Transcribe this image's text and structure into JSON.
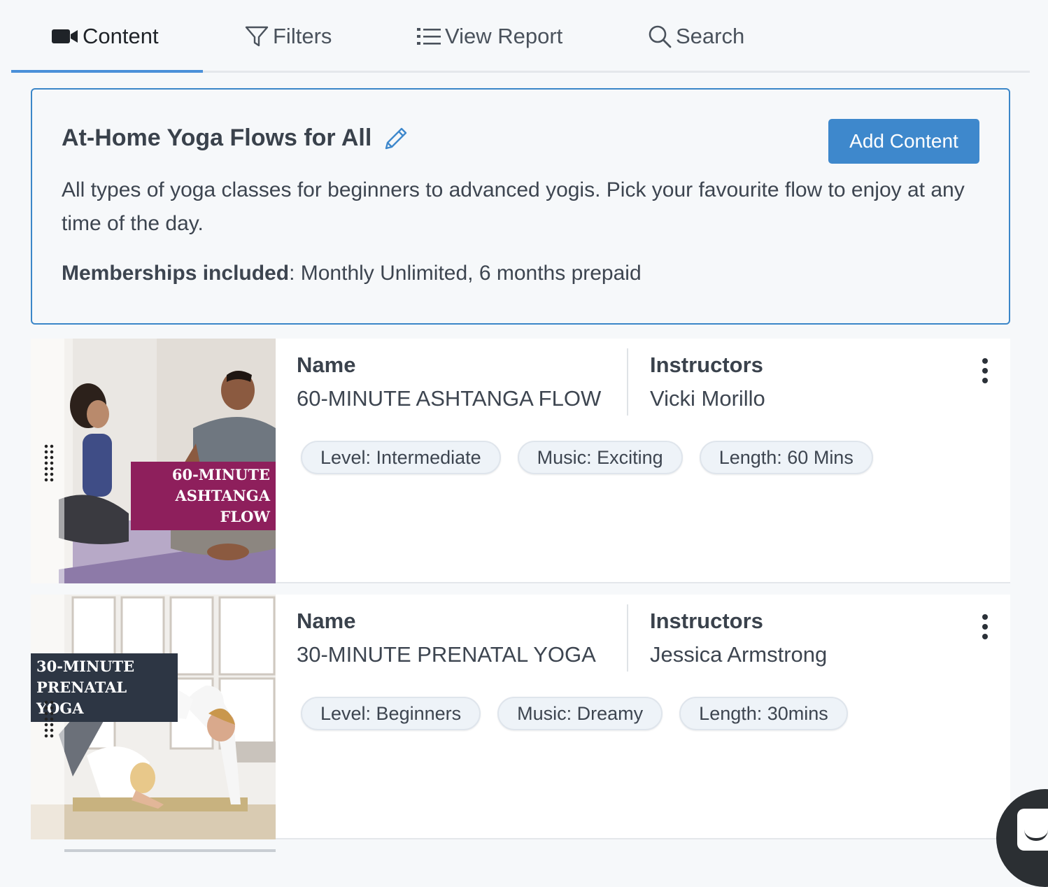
{
  "tabs": [
    {
      "label": "Content",
      "icon": "video-camera-icon",
      "active": true
    },
    {
      "label": "Filters",
      "icon": "filter-funnel-icon",
      "active": false
    },
    {
      "label": "View Report",
      "icon": "list-icon",
      "active": false
    },
    {
      "label": "Search",
      "icon": "search-icon",
      "active": false
    }
  ],
  "collection": {
    "title": "At-Home Yoga Flows for All",
    "edit_icon": "pencil-icon",
    "add_button": "Add Content",
    "description": "All types of yoga classes for beginners to advanced yogis. Pick your favourite flow to enjoy at any time of the day.",
    "memberships_label": "Memberships included",
    "memberships_value": ": Monthly Unlimited, 6 months prepaid"
  },
  "items": [
    {
      "thumb_title_line1": "60-MINUTE",
      "thumb_title_line2": "ASHTANGA FLOW",
      "name_label": "Name",
      "name": "60-MINUTE ASHTANGA FLOW",
      "instructors_label": "Instructors",
      "instructor": "Vicki Morillo",
      "tags": [
        "Level: Intermediate",
        "Music: Exciting",
        "Length: 60 Mins"
      ]
    },
    {
      "thumb_title_line1": "30-MINUTE",
      "thumb_title_line2": "PRENATAL YOGA",
      "name_label": "Name",
      "name": "30-MINUTE PRENATAL YOGA",
      "instructors_label": "Instructors",
      "instructor": "Jessica Armstrong",
      "tags": [
        "Level: Beginners",
        "Music: Dreamy",
        "Length: 30mins"
      ]
    }
  ],
  "colors": {
    "accent": "#3e88cc",
    "ashtanga_label_bg": "#8e1f5c",
    "prenatal_label_bg": "#2d3644"
  }
}
